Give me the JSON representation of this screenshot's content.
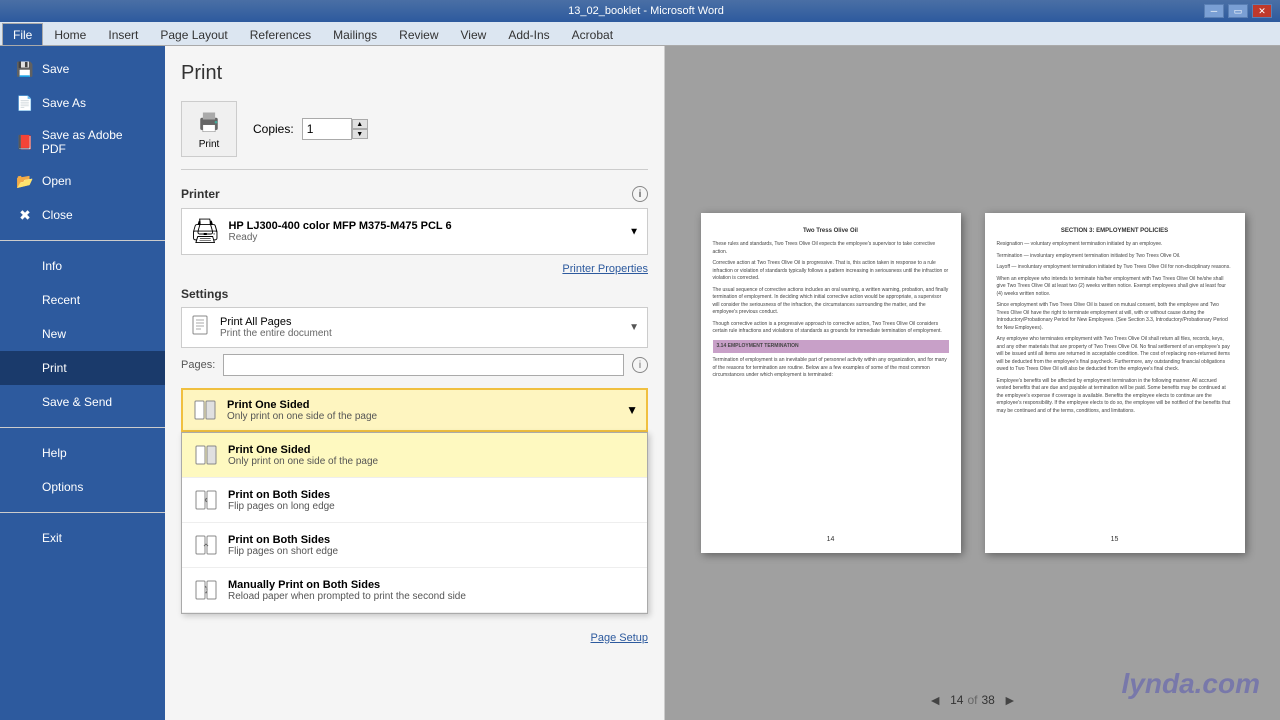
{
  "titleBar": {
    "title": "13_02_booklet - Microsoft Word",
    "controls": [
      "minimize",
      "restore",
      "close"
    ]
  },
  "ribbon": {
    "tabs": [
      "File",
      "Home",
      "Insert",
      "Page Layout",
      "References",
      "Mailings",
      "Review",
      "View",
      "Add-Ins",
      "Acrobat"
    ],
    "activeTab": "File"
  },
  "sidebar": {
    "items": [
      {
        "id": "save",
        "label": "Save",
        "icon": "💾"
      },
      {
        "id": "save-as",
        "label": "Save As",
        "icon": "📄"
      },
      {
        "id": "save-adobe",
        "label": "Save as Adobe PDF",
        "icon": "📕"
      },
      {
        "id": "open",
        "label": "Open",
        "icon": "📂"
      },
      {
        "id": "close",
        "label": "Close",
        "icon": "✖"
      },
      {
        "id": "info",
        "label": "Info",
        "icon": ""
      },
      {
        "id": "recent",
        "label": "Recent",
        "icon": ""
      },
      {
        "id": "new",
        "label": "New",
        "icon": ""
      },
      {
        "id": "print",
        "label": "Print",
        "icon": ""
      },
      {
        "id": "save-send",
        "label": "Save & Send",
        "icon": ""
      },
      {
        "id": "help",
        "label": "Help",
        "icon": ""
      },
      {
        "id": "options",
        "label": "Options",
        "icon": ""
      },
      {
        "id": "exit",
        "label": "Exit",
        "icon": ""
      }
    ]
  },
  "printPanel": {
    "title": "Print",
    "printButton": "Print",
    "copies": {
      "label": "Copies:",
      "value": "1"
    },
    "printer": {
      "sectionLabel": "Printer",
      "name": "HP LJ300-400 color MFP M375-M475 PCL 6",
      "status": "Ready",
      "printerPropertiesLink": "Printer Properties"
    },
    "settings": {
      "sectionLabel": "Settings",
      "printAllPages": {
        "main": "Print All Pages",
        "sub": "Print the entire document"
      },
      "pages": {
        "label": "Pages:",
        "placeholder": ""
      },
      "sidesSelected": {
        "main": "Print One Sided",
        "sub": "Only print on one side of the page"
      },
      "sidesOptions": [
        {
          "id": "one-sided",
          "main": "Print One Sided",
          "sub": "Only print on one side of the page",
          "selected": true
        },
        {
          "id": "both-long",
          "main": "Print on Both Sides",
          "sub": "Flip pages on long edge",
          "selected": false
        },
        {
          "id": "both-short",
          "main": "Print on Both Sides",
          "sub": "Flip pages on short edge",
          "selected": false
        },
        {
          "id": "manually",
          "main": "Manually Print on Both Sides",
          "sub": "Reload paper when prompted to print the second side",
          "selected": false
        }
      ],
      "pageSetupLink": "Page Setup"
    }
  },
  "preview": {
    "page14": {
      "title": "Two Tress Olive Oil",
      "paragraphs": [
        "These rules and standards, Two Trees Olive Oil expects the employee's supervisor to take corrective action.",
        "Corrective action at Two Trees Olive Oil is progressive. That is, this action taken in response to a rule infraction or violation of standards typically follows a pattern increasing in seriousness until the infraction or violation is corrected.",
        "The usual sequence of corrective actions includes an oral warning, a written warning, probation, and finally termination of employment. In deciding which initial corrective action would be appropriate, a supervisor will consider the seriousness of the infraction, the circumstances surrounding the matter, and the employee's previous conduct.",
        "Though corrective action is a progressive approach to corrective action, Two Trees Olive Oil considers certain rule infractions and violations of standards as grounds for immediate termination of employment.",
        "3.14 EMPLOYMENT TERMINATION",
        "Termination of employment is an inevitable part of personnel activity within any organization..."
      ],
      "pageNumber": "14"
    },
    "page15": {
      "title": "SECTION 3: EMPLOYMENT POLICIES",
      "paragraphs": [
        "Resignation — voluntary employment termination initiated by an employee.",
        "Termination — involuntary employment termination initiated by Two Trees Olive Oil.",
        "Layoff — involuntary employment termination initiated by Two Trees Olive Oil for non-disciplinary reasons.",
        "When an employee who intends to terminate his/her employment with Two Trees Olive Oil he/she shall give Two Trees Olive Oil at least two (2) weeks written notice.",
        "Since employment with Two Trees Olive Oil is based on mutual consent, both the employee and Two Trees Olive Oil have the right to terminate employment at will, with or without cause.",
        "Any employee who terminates employment with Two Trees Olive Oil shall return all files, records, keys, and any other materials that are property of Two Trees Olive Oil."
      ],
      "pageNumber": "15"
    },
    "navigation": {
      "prevArrow": "◄",
      "nextArrow": "►",
      "currentPage": "14",
      "ofText": "of",
      "totalPages": "38"
    }
  },
  "watermark": {
    "text": "lynda.com"
  }
}
